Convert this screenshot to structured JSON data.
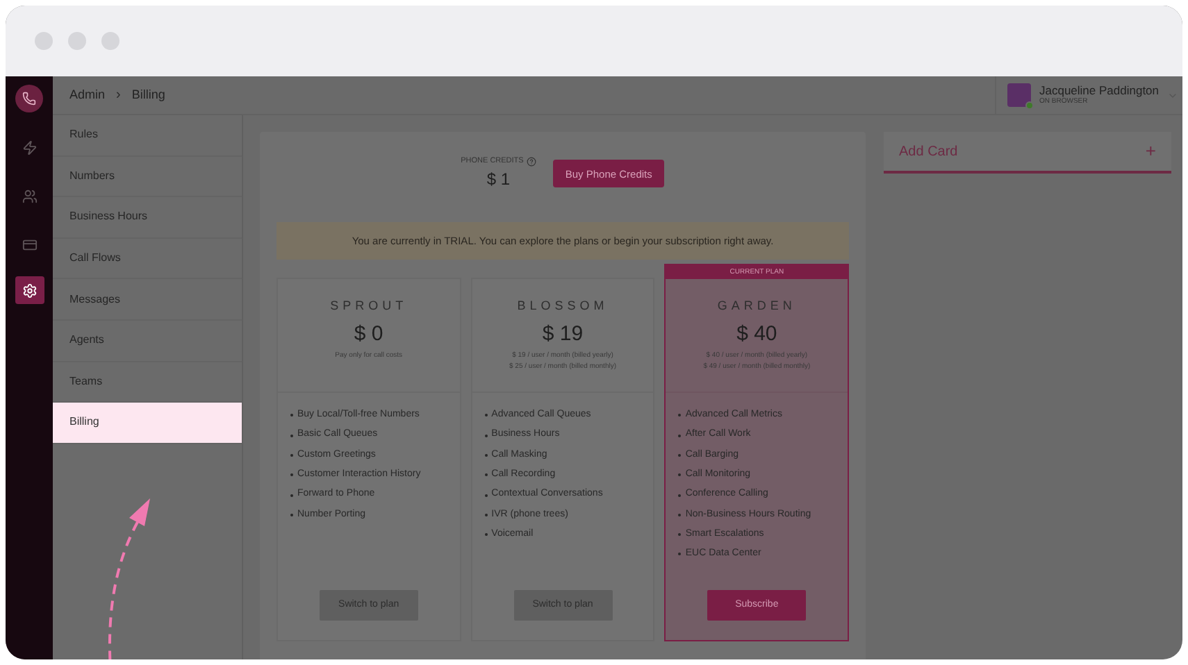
{
  "breadcrumb": [
    "Admin",
    "Billing"
  ],
  "breadcrumb_separator": "›",
  "user": {
    "name": "Jacqueline Paddington",
    "status": "ON BROWSER",
    "online": true
  },
  "rail": [
    {
      "kind": "calls",
      "selected": false
    },
    {
      "kind": "activity",
      "selected": false
    },
    {
      "kind": "contacts",
      "selected": false
    },
    {
      "kind": "card",
      "selected": false
    },
    {
      "kind": "settings",
      "selected": true
    }
  ],
  "nav": [
    {
      "label": "Rules",
      "selected": false
    },
    {
      "label": "Numbers",
      "selected": false
    },
    {
      "label": "Business Hours",
      "selected": false
    },
    {
      "label": "Call Flows",
      "selected": false
    },
    {
      "label": "Messages",
      "selected": false
    },
    {
      "label": "Agents",
      "selected": false
    },
    {
      "label": "Teams",
      "selected": false
    },
    {
      "label": "Billing",
      "selected": true
    }
  ],
  "credits": {
    "label": "PHONE CREDITS",
    "amount": "$ 1",
    "button": "Buy Phone Credits"
  },
  "banner": "You are currently in TRIAL. You can explore the plans or begin your subscription right away.",
  "plans": [
    {
      "name": "SPROUT",
      "price": "$ 0",
      "notes": [
        "Pay only for call costs"
      ],
      "current": false,
      "features": [
        "Buy Local/Toll-free Numbers",
        "Basic Call Queues",
        "Custom Greetings",
        "Customer Interaction History",
        "Forward to Phone",
        "Number Porting"
      ],
      "button": "Switch to plan"
    },
    {
      "name": "BLOSSOM",
      "price": "$ 19",
      "notes": [
        "$ 19 / user / month (billed yearly)",
        "$ 25 / user / month (billed monthly)"
      ],
      "current": false,
      "features": [
        "Advanced Call Queues",
        "Business Hours",
        "Call Masking",
        "Call Recording",
        "Contextual Conversations",
        "IVR (phone trees)",
        "Voicemail"
      ],
      "button": "Switch to plan"
    },
    {
      "name": "GARDEN",
      "price": "$ 40",
      "notes": [
        "$ 40 / user / month (billed yearly)",
        "$ 49 / user / month (billed monthly)"
      ],
      "current": true,
      "current_label": "CURRENT PLAN",
      "features": [
        "Advanced Call Metrics",
        "After Call Work",
        "Call Barging",
        "Call Monitoring",
        "Conference Calling",
        "Non-Business Hours Routing",
        "Smart Escalations",
        "EUC Data Center"
      ],
      "button": "Subscribe"
    }
  ],
  "add_card": {
    "label": "Add Card",
    "icon": "+"
  }
}
